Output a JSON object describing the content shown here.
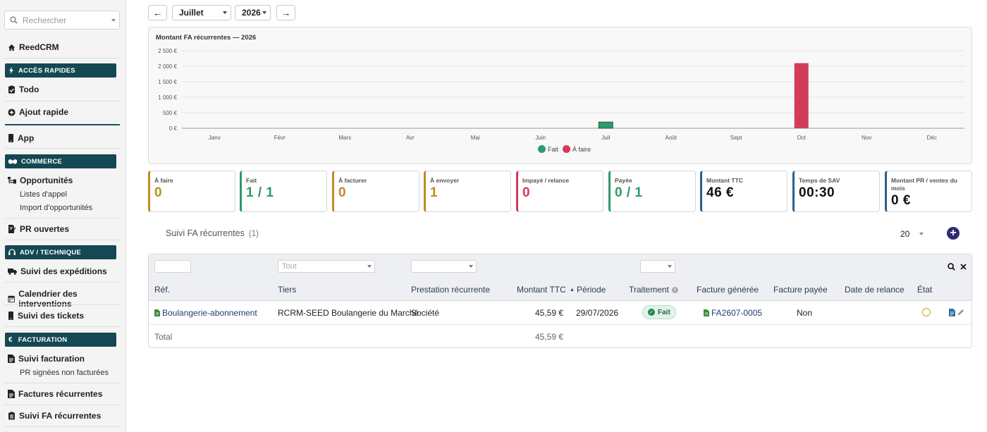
{
  "sidebar": {
    "search_placeholder": "Rechercher",
    "home_label": "ReedCRM",
    "sections": {
      "acces": "ACCÈS RAPIDES",
      "commerce": "COMMERCE",
      "adv": "ADV / TECHNIQUE",
      "facturation": "FACTURATION"
    },
    "items": {
      "todo": "Todo",
      "ajout": "Ajout rapide",
      "app": "App",
      "opportunites": "Opportunités",
      "listes_appel": "Listes d'appel",
      "import_opp": "Import d'opportunités",
      "pr_ouvertes": "PR ouvertes",
      "expeditions": "Suivi des expéditions",
      "calendrier": "Calendrier des interventions",
      "tickets": "Suivi des tickets",
      "suivi_facturation": "Suivi facturation",
      "pr_signees": "PR signées non facturées",
      "factures_rec": "Factures récurrentes",
      "suivi_fa_rec": "Suivi FA récurrentes"
    }
  },
  "toolbar": {
    "prev": "←",
    "month": "Juillet",
    "year": "2026",
    "next": "→"
  },
  "chart_data": {
    "type": "bar",
    "title": "Montant FA récurrentes — 2026",
    "categories": [
      "Janv",
      "Févr",
      "Mars",
      "Avr",
      "Mai",
      "Juin",
      "Juil",
      "Août",
      "Sept",
      "Oct",
      "Nov",
      "Déc"
    ],
    "series": [
      {
        "name": "Fait",
        "color": "#2e9a6a",
        "values": [
          0,
          0,
          0,
          0,
          0,
          0,
          200,
          0,
          0,
          0,
          0,
          0
        ]
      },
      {
        "name": "À faire",
        "color": "#d23c58",
        "values": [
          0,
          0,
          0,
          0,
          0,
          0,
          0,
          0,
          0,
          2100,
          0,
          0
        ]
      }
    ],
    "y_ticks": [
      "0 €",
      "500 €",
      "1 000 €",
      "1 500 €",
      "2 000 €",
      "2 500 €"
    ],
    "ylim": [
      0,
      2500
    ],
    "stacked": true,
    "grid": true,
    "legend": "bottom-center"
  },
  "kpis": [
    {
      "label": "À faire",
      "value": "0",
      "color": "#c08a24"
    },
    {
      "label": "Fait",
      "value": "1 / 1",
      "color": "#2e9a6a"
    },
    {
      "label": "À facturer",
      "value": "0",
      "color": "#c08a24"
    },
    {
      "label": "À envoyer",
      "value": "1",
      "color": "#c08a24"
    },
    {
      "label": "Impayé / relance",
      "value": "0",
      "color": "#d23c58"
    },
    {
      "label": "Payée",
      "value": "0 / 1",
      "color": "#2e9a6a"
    },
    {
      "label": "Montant TTC",
      "value": "46 €",
      "color": "#2c5f8a"
    },
    {
      "label": "Temps de SAV",
      "value": "00:30",
      "color": "#2c5f8a"
    },
    {
      "label": "Montant PR / ventes du mois",
      "value": "0 €",
      "color": "#2c5f8a"
    }
  ],
  "list": {
    "title": "Suivi FA récurrentes",
    "count": "(1)",
    "per_page": "20",
    "tiers_filter_placeholder": "Tout",
    "columns": {
      "ref": "Réf.",
      "tiers": "Tiers",
      "prestation": "Prestation récurrente",
      "montant": "Montant TTC",
      "periode": "Période",
      "traitement": "Traitement",
      "facture": "Facture générée",
      "payee": "Facture payée",
      "relance": "Date de relance",
      "etat": "État"
    },
    "rows": [
      {
        "ref": "Boulangerie-abonnement",
        "tiers": "RCRM-SEED Boulangerie du Marché",
        "prestation": "Société",
        "montant": "45,59 €",
        "periode": "29/07/2026",
        "traitement": "Fait",
        "facture": "FA2607-0005",
        "payee": "Non",
        "relance": ""
      }
    ],
    "total_label": "Total",
    "total_value": "45,59 €"
  }
}
